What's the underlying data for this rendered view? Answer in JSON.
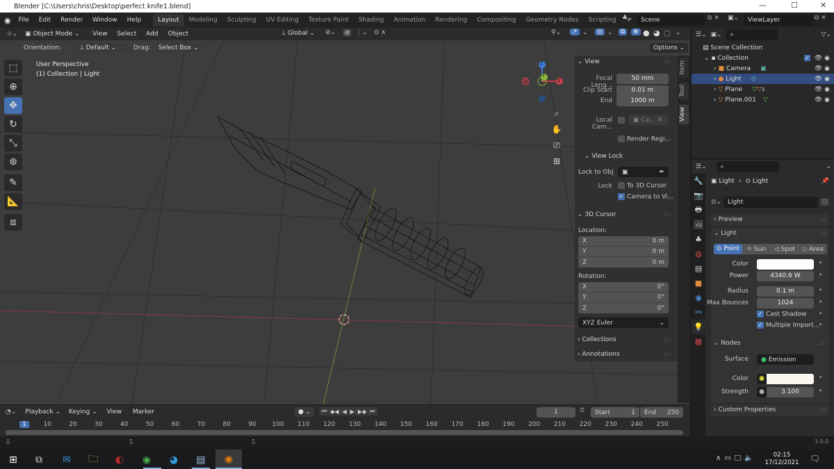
{
  "window": {
    "title": "Blender [C:\\Users\\chris\\Desktop\\perfect knife1.blend]",
    "minimize": "—",
    "maximize": "☐",
    "close": "✕"
  },
  "menu": [
    "File",
    "Edit",
    "Render",
    "Window",
    "Help"
  ],
  "workspaces": [
    "Layout",
    "Modeling",
    "Sculpting",
    "UV Editing",
    "Texture Paint",
    "Shading",
    "Animation",
    "Rendering",
    "Compositing",
    "Geometry Nodes",
    "Scripting",
    "+"
  ],
  "active_workspace": "Layout",
  "scene": {
    "name": "Scene",
    "view_layer": "ViewLayer"
  },
  "viewport": {
    "mode": "Object Mode",
    "menus": [
      "View",
      "Select",
      "Add",
      "Object"
    ],
    "transform_orientation": "Global",
    "orientation_label": "Orientation:",
    "orientation_value": "Default",
    "drag_label": "Drag:",
    "drag_value": "Select Box",
    "options": "Options",
    "overlay_text_1": "User Perspective",
    "overlay_text_2": "(1) Collection | Light",
    "gizmo": {
      "z": "Z",
      "y": "Y",
      "x": "X"
    },
    "axis_x_color": "#c8404a",
    "axis_y_color": "#8bb63a",
    "axis_z_color": "#3c7bd6"
  },
  "npanel": {
    "tabs": [
      "Item",
      "Tool",
      "View"
    ],
    "active_tab": "View",
    "view": {
      "title": "View",
      "focal_label": "Focal Leng...",
      "focal": "50 mm",
      "clip_start_label": "Clip Start",
      "clip_start": "0.01 m",
      "end_label": "End",
      "end": "1000 m",
      "local_cam_label": "Local Cam...",
      "local_cam": "Ca...",
      "render_region": "Render Regi..."
    },
    "view_lock": {
      "title": "View Lock",
      "lock_obj_label": "Lock to Obj",
      "lock_label": "Lock",
      "to_cursor": "To 3D Cursor",
      "camera_to_view": "Camera to Vi...",
      "camera_to_view_checked": true
    },
    "cursor": {
      "title": "3D Cursor",
      "location": "Location:",
      "loc": [
        {
          "axis": "X",
          "value": "0 m"
        },
        {
          "axis": "Y",
          "value": "0 m"
        },
        {
          "axis": "Z",
          "value": "0 m"
        }
      ],
      "rotation": "Rotation:",
      "rot": [
        {
          "axis": "X",
          "value": "0°"
        },
        {
          "axis": "Y",
          "value": "0°"
        },
        {
          "axis": "Z",
          "value": "0°"
        }
      ],
      "mode": "XYZ Euler"
    },
    "collections": "Collections",
    "annotations": "Annotations"
  },
  "outliner": {
    "root": "Scene Collection",
    "collection": "Collection",
    "items": [
      {
        "name": "Camera",
        "selected": false
      },
      {
        "name": "Light",
        "selected": true
      },
      {
        "name": "Plane",
        "selected": false,
        "badge": "3"
      },
      {
        "name": "Plane.001",
        "selected": false
      }
    ]
  },
  "properties": {
    "breadcrumb": [
      "Light",
      "Light"
    ],
    "datablock": "Light",
    "preview": "Preview",
    "light_section": "Light",
    "types": [
      "Point",
      "Sun",
      "Spot",
      "Area"
    ],
    "active_type": "Point",
    "color_label": "Color",
    "color": "#ffffff",
    "power_label": "Power",
    "power": "4340.6 W",
    "radius_label": "Radius",
    "radius": "0.1 m",
    "bounces_label": "Max Bounces",
    "bounces": "1024",
    "cast_shadow": "Cast Shadow",
    "multiple_importance": "Multiple Import...",
    "nodes_section": "Nodes",
    "surface_label": "Surface",
    "surface": "Emission",
    "node_color_label": "Color",
    "node_color": "#fbf7f0",
    "strength_label": "Strength",
    "strength": "3.100",
    "custom": "Custom Properties"
  },
  "timeline": {
    "menus": [
      "Playback",
      "Keying",
      "View",
      "Marker"
    ],
    "current_frame": "1",
    "start_label": "Start",
    "start": "1",
    "end_label": "End",
    "end": "250",
    "ticks": [
      "1",
      "10",
      "20",
      "30",
      "40",
      "50",
      "60",
      "70",
      "80",
      "90",
      "100",
      "110",
      "120",
      "130",
      "140",
      "150",
      "160",
      "170",
      "180",
      "190",
      "200",
      "210",
      "220",
      "230",
      "240",
      "250"
    ]
  },
  "status": {
    "version": "3.0.0"
  },
  "taskbar": {
    "time": "02:15",
    "date": "17/12/2021",
    "apps": [
      "windows-start",
      "task-view",
      "mail",
      "file-explorer",
      "app-red",
      "chrome",
      "edge",
      "notepad",
      "blender"
    ]
  },
  "colors": {
    "accent": "#4772b3",
    "selection": "#334d80",
    "viewport_bg": "#3d3d3d"
  }
}
